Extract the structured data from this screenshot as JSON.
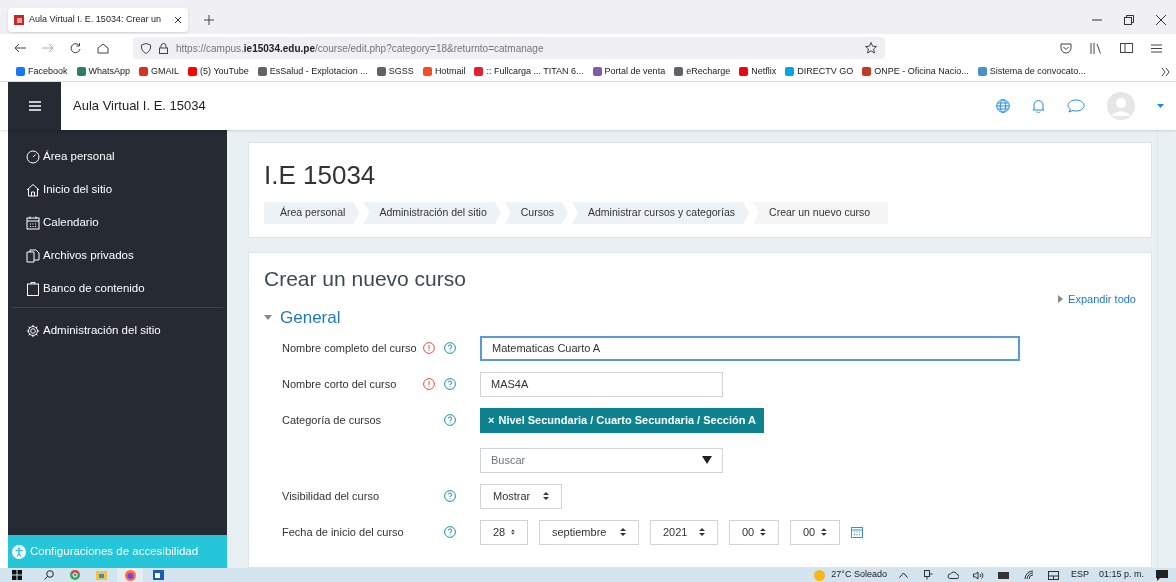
{
  "browser": {
    "tab_title": "Aula Virtual I. E. 15034: Crear un",
    "url": "https://campus.**ie15034.edu.pe**/course/edit.php?category=18&returnto=catmanage",
    "bookmarks": [
      {
        "label": "Facebook",
        "color": "#1877f2"
      },
      {
        "label": "WhatsApp",
        "color": "#2e7d5b"
      },
      {
        "label": "GMAIL",
        "color": "#d93025"
      },
      {
        "label": "(5) YouTube",
        "color": "#ff0000"
      },
      {
        "label": "EsSalud - Explotacion ...",
        "color": "#5f6368"
      },
      {
        "label": "SGSS",
        "color": "#5f6368"
      },
      {
        "label": "Hotmail",
        "color": "#f25022"
      },
      {
        "label": ":: Fullcarga ... TITAN 6...",
        "color": "#e5202e"
      },
      {
        "label": "Portal de venta",
        "color": "#7b5ea7"
      },
      {
        "label": "eRecharge",
        "color": "#5f6368"
      },
      {
        "label": "Netflix",
        "color": "#e50914"
      },
      {
        "label": "DIRECTV GO",
        "color": "#00a6e0"
      },
      {
        "label": "ONPE - Oficina Nacio...",
        "color": "#c0392b"
      },
      {
        "label": "Sistema de convocato...",
        "color": "#4a90c8"
      }
    ]
  },
  "site": {
    "name": "Aula Virtual I. E. 15034"
  },
  "sidebar": {
    "items": [
      {
        "label": "Área personal",
        "kind": "dashboard",
        "divider_before": false
      },
      {
        "label": "Inicio del sitio",
        "kind": "home",
        "divider_before": false
      },
      {
        "label": "Calendario",
        "kind": "calendar",
        "divider_before": false
      },
      {
        "label": "Archivos privados",
        "kind": "files",
        "divider_before": false
      },
      {
        "label": "Banco de contenido",
        "kind": "clipboard",
        "divider_before": false
      },
      {
        "label": "Administración del sitio",
        "kind": "gear",
        "divider_before": true
      }
    ],
    "accessibility": "Configuraciones de accesibilidad"
  },
  "page": {
    "title": "I.E 15034",
    "breadcrumb": [
      {
        "label": "Área personal",
        "current": false
      },
      {
        "label": "Administración del sitio",
        "current": false
      },
      {
        "label": "Cursos",
        "current": false
      },
      {
        "label": "Administrar cursos y categorías",
        "current": false
      },
      {
        "label": "Crear un nuevo curso",
        "current": true
      }
    ]
  },
  "form": {
    "title": "Crear un nuevo curso",
    "expand_all": "Expandir todo",
    "section": {
      "title": "General",
      "expanded": true
    },
    "fields": [
      {
        "kind": "text",
        "label": "Nombre completo del curso",
        "required": true,
        "help": true,
        "value": "Matematicas Cuarto A",
        "focused": true
      },
      {
        "kind": "text",
        "label": "Nombre corto del curso",
        "required": true,
        "help": true,
        "value": "MAS4A",
        "focused": false
      },
      {
        "kind": "tag",
        "label": "Categoría de cursos",
        "required": false,
        "help": true,
        "remove": "×",
        "value": "Nivel Secundaria / Cuarto Secundaria / Sección A"
      },
      {
        "kind": "search",
        "placeholder": "Buscar"
      },
      {
        "kind": "select",
        "label": "Visibilidad del curso",
        "required": false,
        "help": true,
        "value": "Mostrar"
      },
      {
        "kind": "date",
        "label": "Fecha de inicio del curso",
        "required": false,
        "help": true,
        "values": [
          "28",
          "septiembre",
          "2021",
          "00",
          "00"
        ]
      }
    ]
  },
  "taskbar": {
    "weather": "27°C Soleado",
    "language": "ESP",
    "time": "01:15 p. m."
  }
}
